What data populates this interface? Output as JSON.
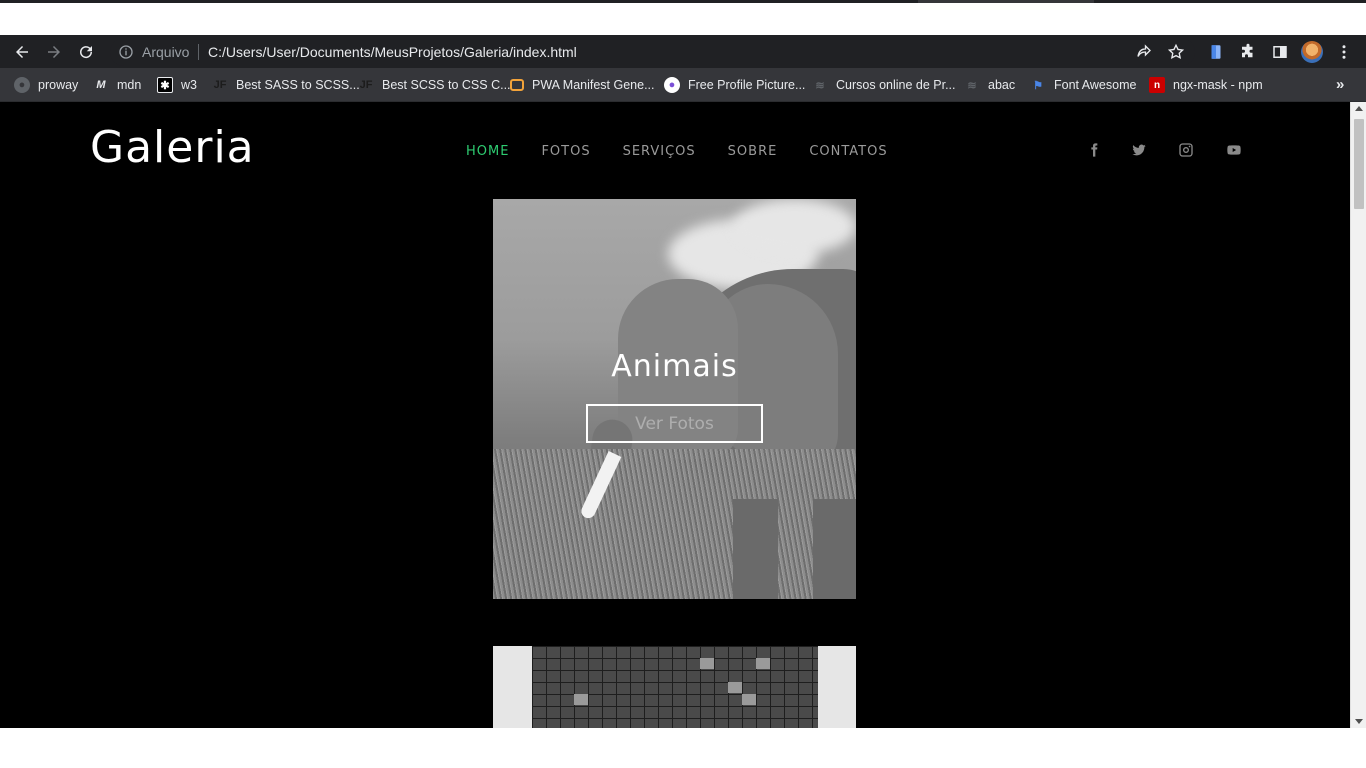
{
  "browser": {
    "omnibox": {
      "scheme_label": "Arquivo",
      "url": "C:/Users/User/Documents/MeusProjetos/Galeria/index.html"
    },
    "bookmarks": [
      {
        "label": "proway",
        "icon": "globe-icon"
      },
      {
        "label": "mdn",
        "icon": "mdn-icon"
      },
      {
        "label": "w3",
        "icon": "w3-icon"
      },
      {
        "label": "Best SASS to SCSS...",
        "icon": "jf-icon"
      },
      {
        "label": "Best SCSS to CSS C...",
        "icon": "jf-icon"
      },
      {
        "label": "PWA Manifest Gene...",
        "icon": "pwa-icon"
      },
      {
        "label": "Free Profile Picture...",
        "icon": "profile-pic-icon"
      },
      {
        "label": "Cursos online de Pr...",
        "icon": "course-icon"
      },
      {
        "label": "abac",
        "icon": "course-icon"
      },
      {
        "label": "Font Awesome",
        "icon": "flag-icon"
      },
      {
        "label": "ngx-mask - npm",
        "icon": "npm-icon"
      }
    ],
    "more_bookmarks": "»"
  },
  "site": {
    "logo": "Galeria",
    "nav": [
      {
        "label": "HOME",
        "active": true
      },
      {
        "label": "FOTOS",
        "active": false
      },
      {
        "label": "SERVIÇOS",
        "active": false
      },
      {
        "label": "SOBRE",
        "active": false
      },
      {
        "label": "CONTATOS",
        "active": false
      }
    ],
    "social": [
      "facebook-icon",
      "twitter-icon",
      "instagram-icon",
      "youtube-icon"
    ],
    "gallery": [
      {
        "title": "Animais",
        "button": "Ver Fotos"
      }
    ],
    "accent_color": "#2ecc71"
  }
}
